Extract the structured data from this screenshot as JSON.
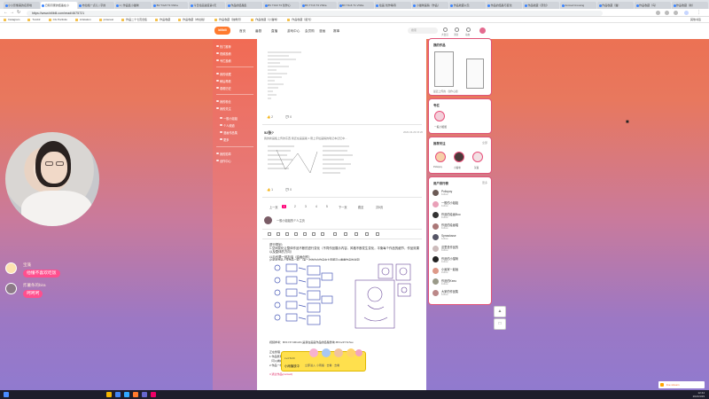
{
  "browser": {
    "tabs": [
      "小小影像美的名家地",
      "日积月累的结晶在小",
      "布拉格一点儿 | 字的",
      "1 | 作品集小猫咪",
      "BV T4v6 T3 VNFa",
      "今日绘画进度第1天",
      "作品的结晶集",
      "BV T3v6 T4 创作心",
      "BV T7v6 T3 VNFa",
      "BV T4v6 T1 VNFa",
      "绘画·创作等待",
      "小猫咪画稿（作品）",
      "作品收藏以及",
      "作品的结晶与变化",
      "作品收藏（原创）",
      "Animal Crossing",
      "作品收藏（猫）",
      "作品收藏（鸟）",
      "作品收藏（新）"
    ],
    "url": "https://www.bilibili.com/read/4675721",
    "bookmarks": [
      "Instagram",
      "Tumblr",
      "CG Portfolio",
      "Artstation",
      "pinterest",
      "作品二十七页合集",
      "作品收藏",
      "作品收藏（布拉格）",
      "作品收藏（独角兽）",
      "作品收藏（小猫咪）",
      "作品收藏（星光）"
    ],
    "bookmarks_right": "其他书签"
  },
  "site": {
    "logo": "bilibili",
    "nav": [
      "首页",
      "番剧",
      "直播",
      "游戏中心",
      "会员购",
      "漫画",
      "赛事"
    ],
    "search_placeholder": "搜索",
    "nav_icons": [
      "大会员",
      "消息",
      "动态",
      "收藏",
      "历史"
    ]
  },
  "sidebar": {
    "items": [
      "热门推荐",
      "视频投稿",
      "专栏投稿",
      "我的收藏",
      "稍后再看",
      "观看历史",
      "我的粉丝",
      "我的关注",
      "一般小姐姐",
      "个人频道",
      "漫画作品集",
      "更多",
      "我的勋章",
      "创作中心"
    ]
  },
  "post1": {
    "likes": "2",
    "comments": "0"
  },
  "post2": {
    "title": "52张?",
    "body": "我的新画板上传的东西 我还在画画着 1 刚上手绘画稿的笔记本记忆中…",
    "time": "2020-04-29 15:20",
    "likes": "1",
    "comments": "0"
  },
  "pagination": {
    "prev": "上一页",
    "pages": [
      "1",
      "2",
      "3",
      "4",
      "5"
    ],
    "current": "1",
    "next": "下一页",
    "jump": "跳至",
    "total": "共5页"
  },
  "composer": {
    "author": "一般小姐姐的个人主页",
    "lines": [
      "进行规划：",
      "1.空间变化让整体作品不断的进行变化（不同作品展示内容，风格不断发生变化，平衡每个作品的细节，作品效果以及整体的方向）",
      "以后也要一起加油（绘画创作）",
      "(2)最新作品上传作品一起：（第一次的也在作品中大家都可以看看作品的进度）"
    ],
    "ref": "视频参考：BV1Y4Y1R1A6 (是我在画画作品的结晶整体) BV1v4Y7a7au",
    "tail_head": "正在整理",
    "tail": [
      "1.作品整理出来的作品（参考作品整体）",
      "（可以看看作品的方向哦哦哦）",
      "2.作品一样的作品",
      "3.通过作品(contact)"
    ]
  },
  "popup": {
    "label": "Lv4 5/20",
    "text": "小雨播放中",
    "sub": "立即进入 小雨播 · 去看 · 去看"
  },
  "right": {
    "card1_title": "我的作品",
    "card1_caption": "最近上传的 · 创作心愿",
    "card2_title": "专栏",
    "card2_item": "一般小姐姐",
    "card3_title": "推荐关注",
    "card3_more": "全部",
    "card3_names": [
      "Poliopoy",
      "小猫咪",
      "灰猫"
    ],
    "card4_title": "用户排行榜",
    "card4_more": "更多",
    "ranking": [
      {
        "name": "Poliopoy",
        "sub": "Follow"
      },
      {
        "name": "一般的小姐姐",
        "sub": "Follow"
      },
      {
        "name": "作品的绘画Boo",
        "sub": "Follow"
      },
      {
        "name": "作品的绘画喵",
        "sub": "Follow"
      },
      {
        "name": "Sprawlosse",
        "sub": "Follow"
      },
      {
        "name": "这里是作品的",
        "sub": "Follow"
      },
      {
        "name": "作品的小猫咪",
        "sub": "Follow"
      },
      {
        "name": "小画家一起画",
        "sub": "Follow"
      },
      {
        "name": "作品的Keeo",
        "sub": "Follow"
      },
      {
        "name": "大家的作品集",
        "sub": "Follow"
      }
    ]
  },
  "chat": [
    {
      "name": "宝藻",
      "message": "他懂不喜欢吃饭"
    },
    {
      "name": "炸薯条的bira",
      "message": "呵呵呵"
    }
  ],
  "overlay_pill": "live stream",
  "taskbar": {
    "time": "12:44",
    "date": "2021/4/29"
  },
  "colors": {
    "accent": "#ff4f8e",
    "brand": "#ff7a2e",
    "card_border": "#e05378"
  }
}
